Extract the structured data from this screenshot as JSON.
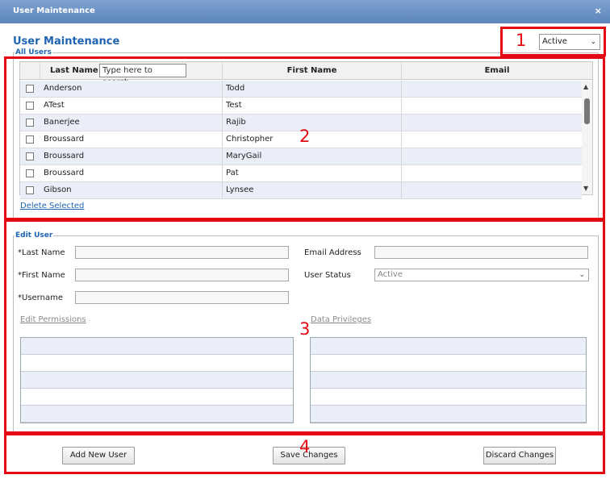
{
  "window": {
    "title": "User Maintenance",
    "close_glyph": "×"
  },
  "page_title": "User Maintenance",
  "status_filter": {
    "value": "Active",
    "chevron": "⌄"
  },
  "all_users": {
    "legend": "All Users",
    "columns": {
      "last_name": "Last Name",
      "first_name": "First Name",
      "email": "Email"
    },
    "search_placeholder": "Type here to search...",
    "rows": [
      {
        "last": "Anderson",
        "first": "Todd",
        "email": ""
      },
      {
        "last": "ATest",
        "first": "Test",
        "email": ""
      },
      {
        "last": "Banerjee",
        "first": "Rajib",
        "email": ""
      },
      {
        "last": "Broussard",
        "first": "Christopher",
        "email": ""
      },
      {
        "last": "Broussard",
        "first": "MaryGail",
        "email": ""
      },
      {
        "last": "Broussard",
        "first": "Pat",
        "email": ""
      },
      {
        "last": "Gibson",
        "first": "Lynsee",
        "email": ""
      }
    ],
    "delete_link": "Delete Selected"
  },
  "edit_user": {
    "legend": "Edit User",
    "last_name_label": "*Last Name",
    "first_name_label": "*First Name",
    "username_label": "*Username",
    "email_label": "Email Address",
    "user_status_label": "User Status",
    "user_status_value": "Active",
    "edit_permissions_link": "Edit Permissions",
    "data_privileges_link": "Data Privileges"
  },
  "actions": {
    "add_new_user": "Add New User",
    "save_changes": "Save Changes",
    "discard_changes": "Discard Changes"
  },
  "callouts": {
    "n1": "1",
    "n2": "2",
    "n3": "3",
    "n4": "4"
  },
  "colors": {
    "title_blue": "#1f64b3",
    "callout_red": "#e50914",
    "row_alt": "#e9eef8"
  }
}
